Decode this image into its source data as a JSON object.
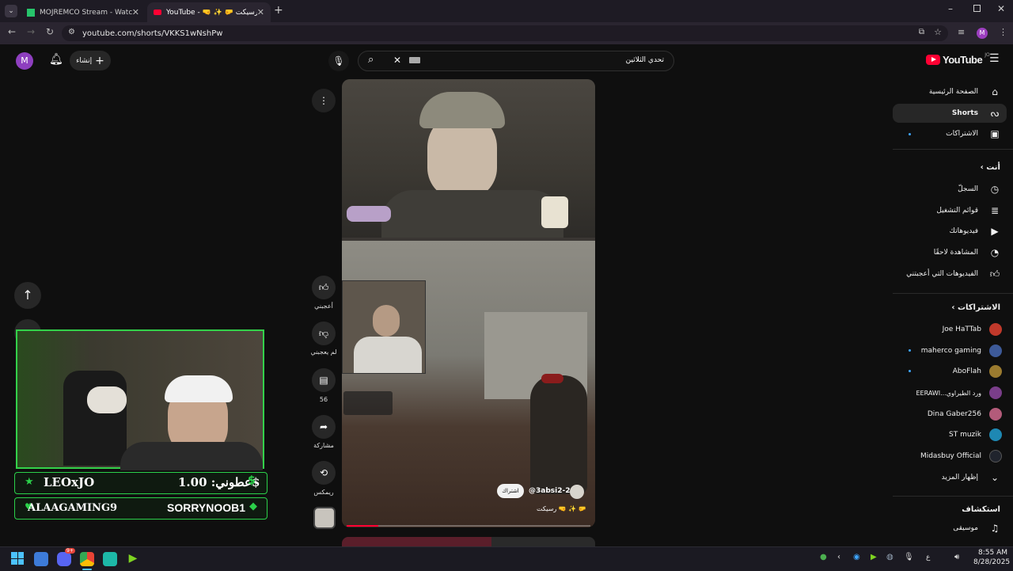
{
  "browser": {
    "tabs": [
      {
        "title": "MOJREMCO Stream - Watch Li...",
        "active": false
      },
      {
        "title": "YouTube - 🤜 ✨ 🤛 رسيكت 🔊",
        "active": true
      }
    ],
    "url": "youtube.com/shorts/VKKS1wNshPw"
  },
  "header": {
    "logo_text": "YouTube",
    "logo_region": "JO",
    "search_value": "تحدي الثلاثين",
    "create_label": "إنشاء",
    "avatar_letter": "M"
  },
  "sidebar": {
    "main": [
      {
        "label": "الصفحة الرئيسية",
        "icon": "home-icon"
      },
      {
        "label": "Shorts",
        "icon": "shorts-icon"
      },
      {
        "label": "الاشتراكات",
        "icon": "subscriptions-icon"
      }
    ],
    "you_title": "أنت",
    "you": [
      {
        "label": "السجلّ",
        "icon": "history-icon"
      },
      {
        "label": "قوائم التشغيل",
        "icon": "playlists-icon"
      },
      {
        "label": "فيديوهاتك",
        "icon": "your-videos-icon"
      },
      {
        "label": "المشاهدة لاحقًا",
        "icon": "watch-later-icon"
      },
      {
        "label": "الفيديوهات التي أعجبتني",
        "icon": "liked-icon"
      }
    ],
    "subs_title": "الاشتراكات",
    "subs": [
      {
        "label": "Joe HaTTab",
        "color": "#c0392b"
      },
      {
        "label": "maherco gaming",
        "color": "#3d5a99"
      },
      {
        "label": "AboFlah",
        "color": "#9b7b2f"
      },
      {
        "label": "EERAWI...ورد الطيراوي",
        "color": "#7a3e8a"
      },
      {
        "label": "Dina Gaber256",
        "color": "#b35b7a"
      },
      {
        "label": "ST muzik",
        "color": "#1e88b3"
      },
      {
        "label": "Midasbuy Official",
        "color": "#20242d"
      }
    ],
    "show_more": "إظهار المزيد",
    "explore_title": "استكشاف",
    "explore": [
      {
        "label": "موسيقى",
        "icon": "music-icon"
      }
    ]
  },
  "actions": {
    "like": "أعجبني",
    "dislike": "لم يعجبني",
    "comments": "56",
    "share": "مشاركة",
    "remix": "ريمكس"
  },
  "video": {
    "channel": "@3absi2-2",
    "subscribe": "اشتراك",
    "caption": "رسيكت 🤜 ✨ 🤛"
  },
  "overlay": {
    "donor1": "LEOxJO",
    "donate_label": "عطوني: 1.00$",
    "donor2": "ALAAGAMING9",
    "donor3": "SORRYNOOB1"
  },
  "taskbar": {
    "time": "8:55 AM",
    "date": "8/28/2025",
    "discord_badge": "9+",
    "lang": "ع"
  }
}
